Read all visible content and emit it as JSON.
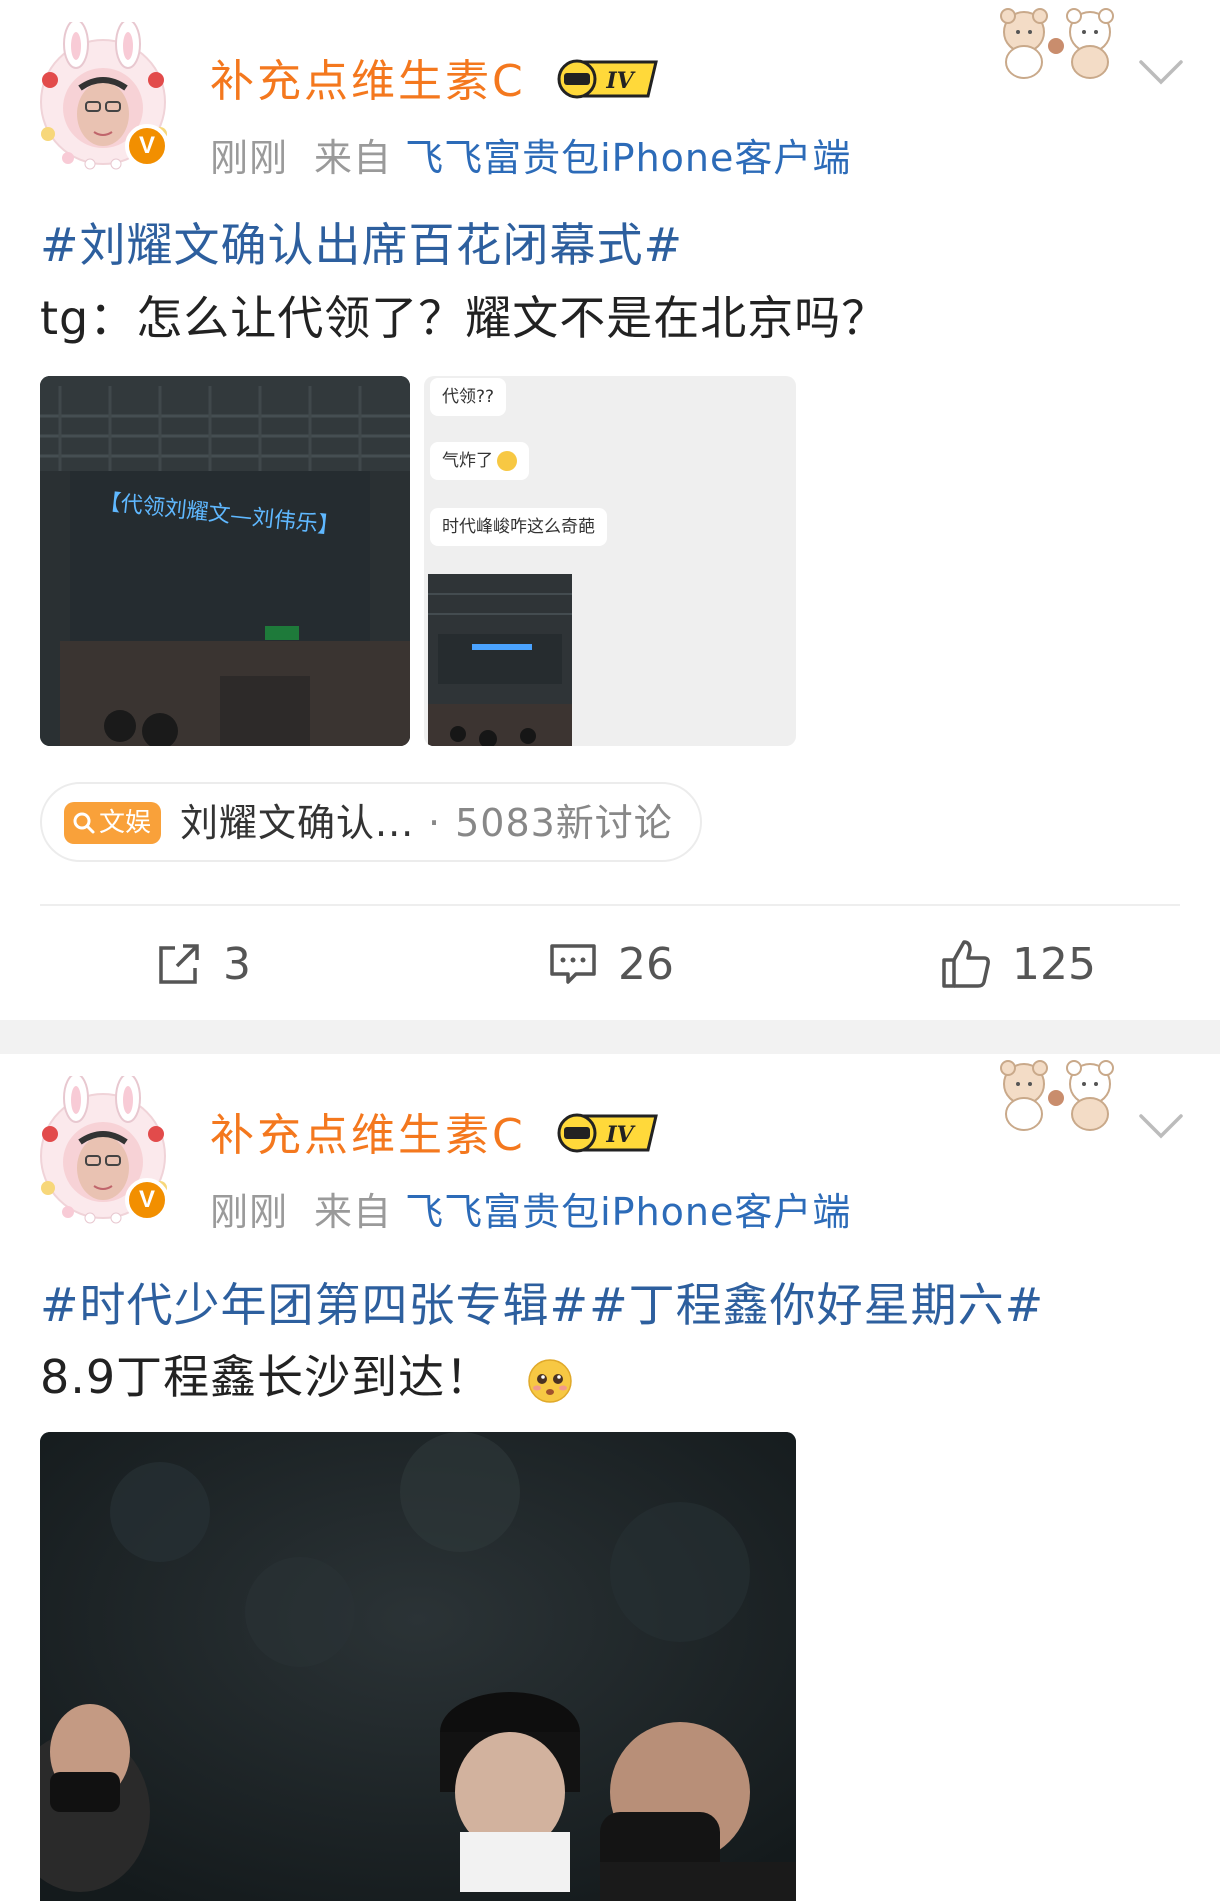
{
  "colors": {
    "username": "#f4781e",
    "topic": "#2d5f9e",
    "source": "#2c6bb8",
    "meta": "#9a9a9a",
    "badge": "#f28f00",
    "chip_tag": "#f9a13a"
  },
  "posts": [
    {
      "user": {
        "name": "补充点维生素C",
        "verified_mark": "V",
        "level": "IV"
      },
      "meta": {
        "time": "刚刚",
        "from": "来自",
        "source": "飞飞富贵包iPhone客户端"
      },
      "topic": "#刘耀文确认出席百花闭幕式#",
      "content": "tg：怎么让代领了？耀文不是在北京吗？",
      "images": {
        "screen_text": "【代领刘耀文—刘伟乐】",
        "chat": [
          "代领??",
          "气炸了",
          "时代峰峻咋这么奇葩"
        ]
      },
      "topic_chip": {
        "tag": "文娱",
        "title": "刘耀文确认...",
        "separator": "·",
        "count": "5083新讨论"
      },
      "actions": {
        "repost_icon": "repost-icon",
        "repost_count": "3",
        "comment_icon": "comment-icon",
        "comment_count": "26",
        "like_icon": "thumbs-up-icon",
        "like_count": "125"
      }
    },
    {
      "user": {
        "name": "补充点维生素C",
        "verified_mark": "V",
        "level": "IV"
      },
      "meta": {
        "time": "刚刚",
        "from": "来自",
        "source": "飞飞富贵包iPhone客户端"
      },
      "topic": "#时代少年团第四张专辑##丁程鑫你好星期六#",
      "content": "8.9丁程鑫长沙到达！"
    }
  ]
}
